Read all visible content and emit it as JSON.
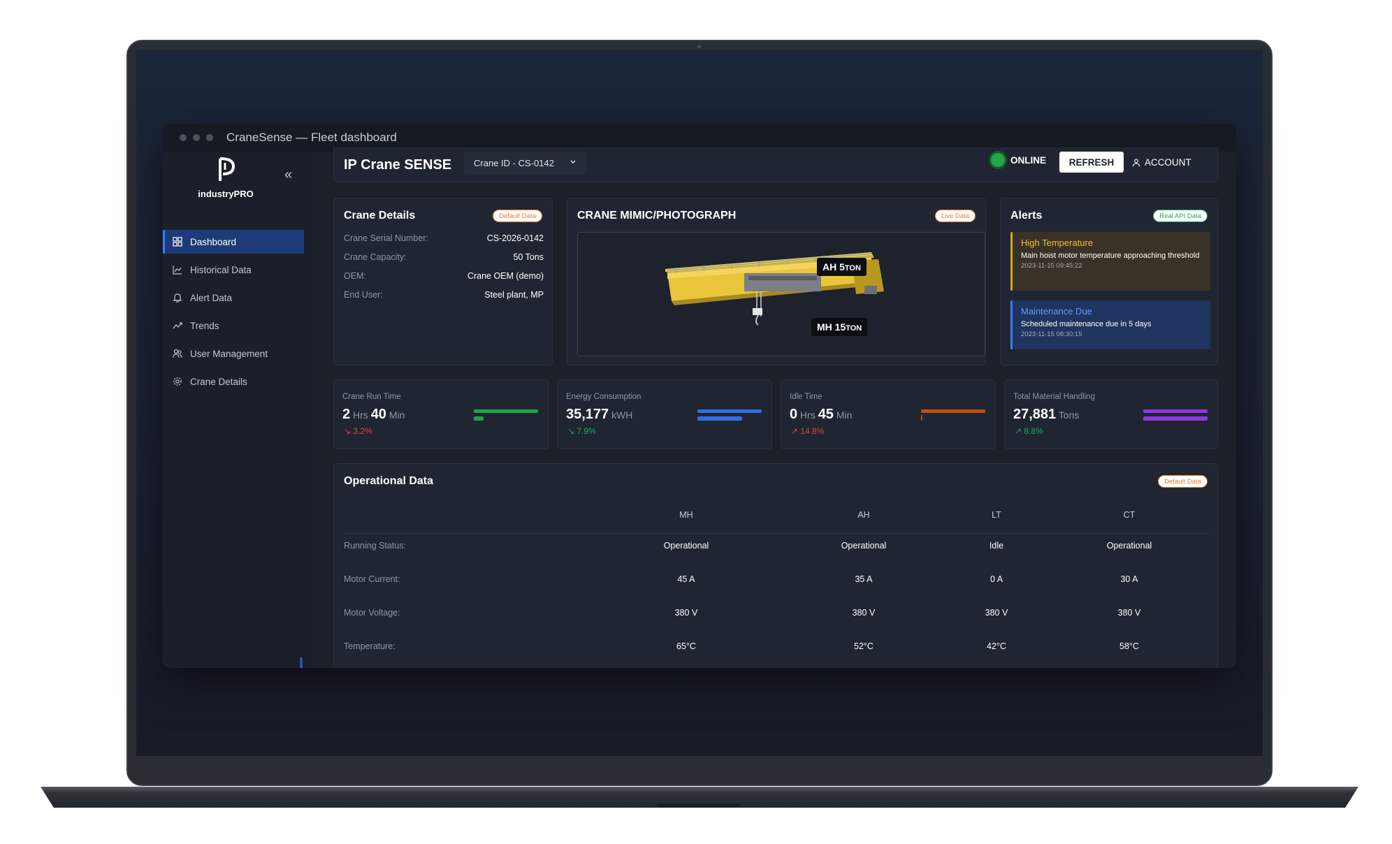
{
  "window": {
    "title": "CraneSense — Fleet dashboard"
  },
  "brand": {
    "logo_text": "industryPRO"
  },
  "sidebar": {
    "collapse_label": "«",
    "items": [
      {
        "label": "Dashboard",
        "icon": "grid-icon",
        "active": true
      },
      {
        "label": "Historical Data",
        "icon": "line-chart-icon"
      },
      {
        "label": "Alert Data",
        "icon": "alarm-icon"
      },
      {
        "label": "Trends",
        "icon": "trend-icon"
      },
      {
        "label": "User Management",
        "icon": "users-icon"
      },
      {
        "label": "Crane Details",
        "icon": "gear-icon"
      }
    ]
  },
  "header": {
    "title": "IP Crane SENSE",
    "crane_select": "Crane ID - CS-0142",
    "status": "ONLINE",
    "refresh_label": "REFRESH",
    "account_label": "ACCOUNT"
  },
  "crane_details": {
    "title": "Crane Details",
    "badge": "Default Data",
    "rows": [
      {
        "label": "Crane Serial Number:",
        "value": "CS-2026-0142"
      },
      {
        "label": "Crane Capacity:",
        "value": "50 Tons"
      },
      {
        "label": "OEM:",
        "value": "Crane OEM (demo)"
      },
      {
        "label": "End User:",
        "value": "Steel plant, MP"
      }
    ]
  },
  "mimic": {
    "title": "CRANE MIMIC/PHOTOGRAPH",
    "badge": "Live Data",
    "ah_tag": "AH 5",
    "ah_unit": "TON",
    "mh_tag": "MH 15",
    "mh_unit": "TON"
  },
  "alerts": {
    "title": "Alerts",
    "badge": "Real API Data",
    "items": [
      {
        "title": "High Temperature",
        "message": "Main hoist motor temperature approaching threshold",
        "time": "2023-11-15 09:45:22"
      },
      {
        "title": "Maintenance Due",
        "message": "Scheduled maintenance due in 5 days",
        "time": "2023-11-15 08:30:15"
      }
    ]
  },
  "kpis": [
    {
      "label": "Crane Run Time",
      "v1": "2",
      "u1": " Hrs ",
      "v2": "40",
      "u2": " Min",
      "change": "↘ 3.2%",
      "direction": "down",
      "color": "#1fa547",
      "fill": 0.15
    },
    {
      "label": "Energy Consumption",
      "v1": "35,177",
      "u1": " kWH",
      "v2": "",
      "u2": "",
      "change": "↘ 7.9%",
      "direction": "up",
      "color": "#2f6ee8",
      "fill": 0.7
    },
    {
      "label": "Idle Time",
      "v1": "0",
      "u1": " Hrs ",
      "v2": "45",
      "u2": " Min",
      "change": "↗ 14.8%",
      "direction": "down",
      "color": "#c24d12",
      "fill": 0.02
    },
    {
      "label": "Total Material Handling",
      "v1": "27,881",
      "u1": " Tons",
      "v2": "",
      "u2": "",
      "change": "↗ 8.8%",
      "direction": "up",
      "color": "#9333ea",
      "fill": 1.0
    }
  ],
  "operational": {
    "title": "Operational Data",
    "badge": "Default Data",
    "columns": [
      "MH",
      "AH",
      "LT",
      "CT"
    ],
    "rows": [
      {
        "label": "Running Status:",
        "values": [
          "Operational",
          "Operational",
          "Idle",
          "Operational"
        ]
      },
      {
        "label": "Motor Current:",
        "values": [
          "45 A",
          "35 A",
          "0 A",
          "30 A"
        ]
      },
      {
        "label": "Motor Voltage:",
        "values": [
          "380 V",
          "380 V",
          "380 V",
          "380 V"
        ]
      },
      {
        "label": "Temperature:",
        "values": [
          "65°C",
          "52°C",
          "42°C",
          "58°C"
        ]
      }
    ]
  },
  "colors": {
    "accent": "#3d7bff",
    "online": "#22a447",
    "warning": "#d4a81a",
    "danger": "#e0443e",
    "success": "#1fa55b"
  }
}
